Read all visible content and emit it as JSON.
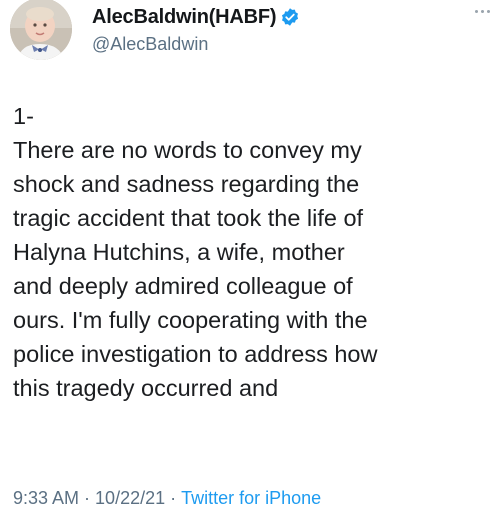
{
  "user": {
    "display_name": "AlecBaldwin(HABF)",
    "handle": "@AlecBaldwin",
    "verified": true
  },
  "tweet": {
    "lines": [
      "1-",
      "There are no words to convey my",
      "shock and sadness regarding the",
      "tragic accident that took the life of",
      "Halyna Hutchins, a wife, mother",
      "and deeply admired colleague of",
      "ours. I'm fully cooperating with the",
      "police investigation to address how",
      "this tragedy occurred and"
    ]
  },
  "meta": {
    "time": "9:33 AM",
    "date": "10/22/21",
    "source": "Twitter for iPhone",
    "separator": "·"
  },
  "colors": {
    "verified": "#1d9bf0",
    "source_link": "#1d9bf0",
    "secondary_text": "#5b7083"
  },
  "icons": {
    "verified": "verified-badge-icon",
    "more": "more-options-icon"
  }
}
